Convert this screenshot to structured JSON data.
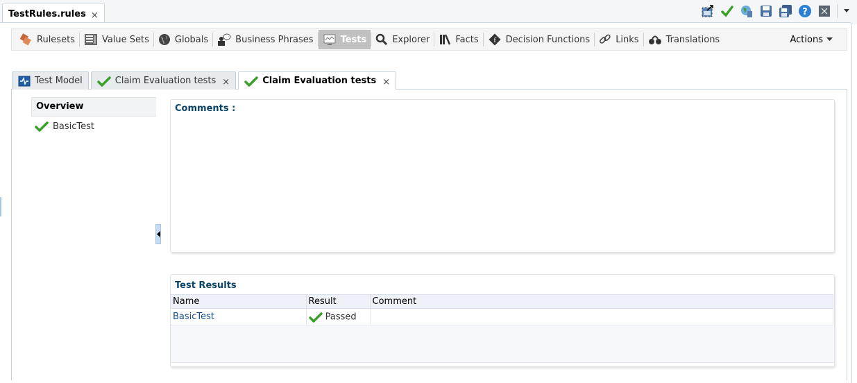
{
  "document_tab": {
    "title": "TestRules.rules",
    "close_icon": "close-icon"
  },
  "toolbar_icons": [
    {
      "name": "export-icon",
      "label": "Export"
    },
    {
      "name": "validate-icon",
      "label": "Validate"
    },
    {
      "name": "translate-icon",
      "label": "Translate"
    },
    {
      "name": "save-icon",
      "label": "Save"
    },
    {
      "name": "save-all-icon",
      "label": "Save All"
    },
    {
      "name": "help-icon",
      "label": "Help"
    },
    {
      "name": "close-window-icon",
      "label": "Close"
    },
    {
      "name": "dropdown-icon",
      "label": "More"
    }
  ],
  "nav": {
    "items": [
      {
        "label": "Rulesets",
        "icon": "rulesets-icon"
      },
      {
        "label": "Value Sets",
        "icon": "value-sets-icon"
      },
      {
        "label": "Globals",
        "icon": "globe-icon"
      },
      {
        "label": "Business Phrases",
        "icon": "business-phrases-icon"
      },
      {
        "label": "Tests",
        "icon": "tests-icon",
        "active": true
      },
      {
        "label": "Explorer",
        "icon": "search-icon"
      },
      {
        "label": "Facts",
        "icon": "facts-icon"
      },
      {
        "label": "Decision Functions",
        "icon": "decision-functions-icon"
      },
      {
        "label": "Links",
        "icon": "links-icon"
      },
      {
        "label": "Translations",
        "icon": "translations-icon"
      }
    ],
    "actions_label": "Actions"
  },
  "subtabs": [
    {
      "label": "Test Model",
      "icon": "test-model-icon",
      "closable": false
    },
    {
      "label": "Claim Evaluation tests",
      "icon": "check-icon",
      "closable": true
    },
    {
      "label": "Claim Evaluation tests",
      "icon": "check-icon",
      "closable": true,
      "active": true
    }
  ],
  "overview": {
    "title": "Overview",
    "items": [
      {
        "label": "BasicTest",
        "status": "passed"
      }
    ]
  },
  "comments": {
    "title": "Comments :",
    "value": ""
  },
  "results": {
    "title": "Test Results",
    "columns": [
      "Name",
      "Result",
      "Comment"
    ],
    "rows": [
      {
        "name": "BasicTest",
        "result": "Passed",
        "comment": ""
      }
    ]
  },
  "colors": {
    "accent": "#0b4568",
    "link": "#1a4f8b",
    "active_nav": "#c0c0c0",
    "check_green": "#3aa02a"
  }
}
